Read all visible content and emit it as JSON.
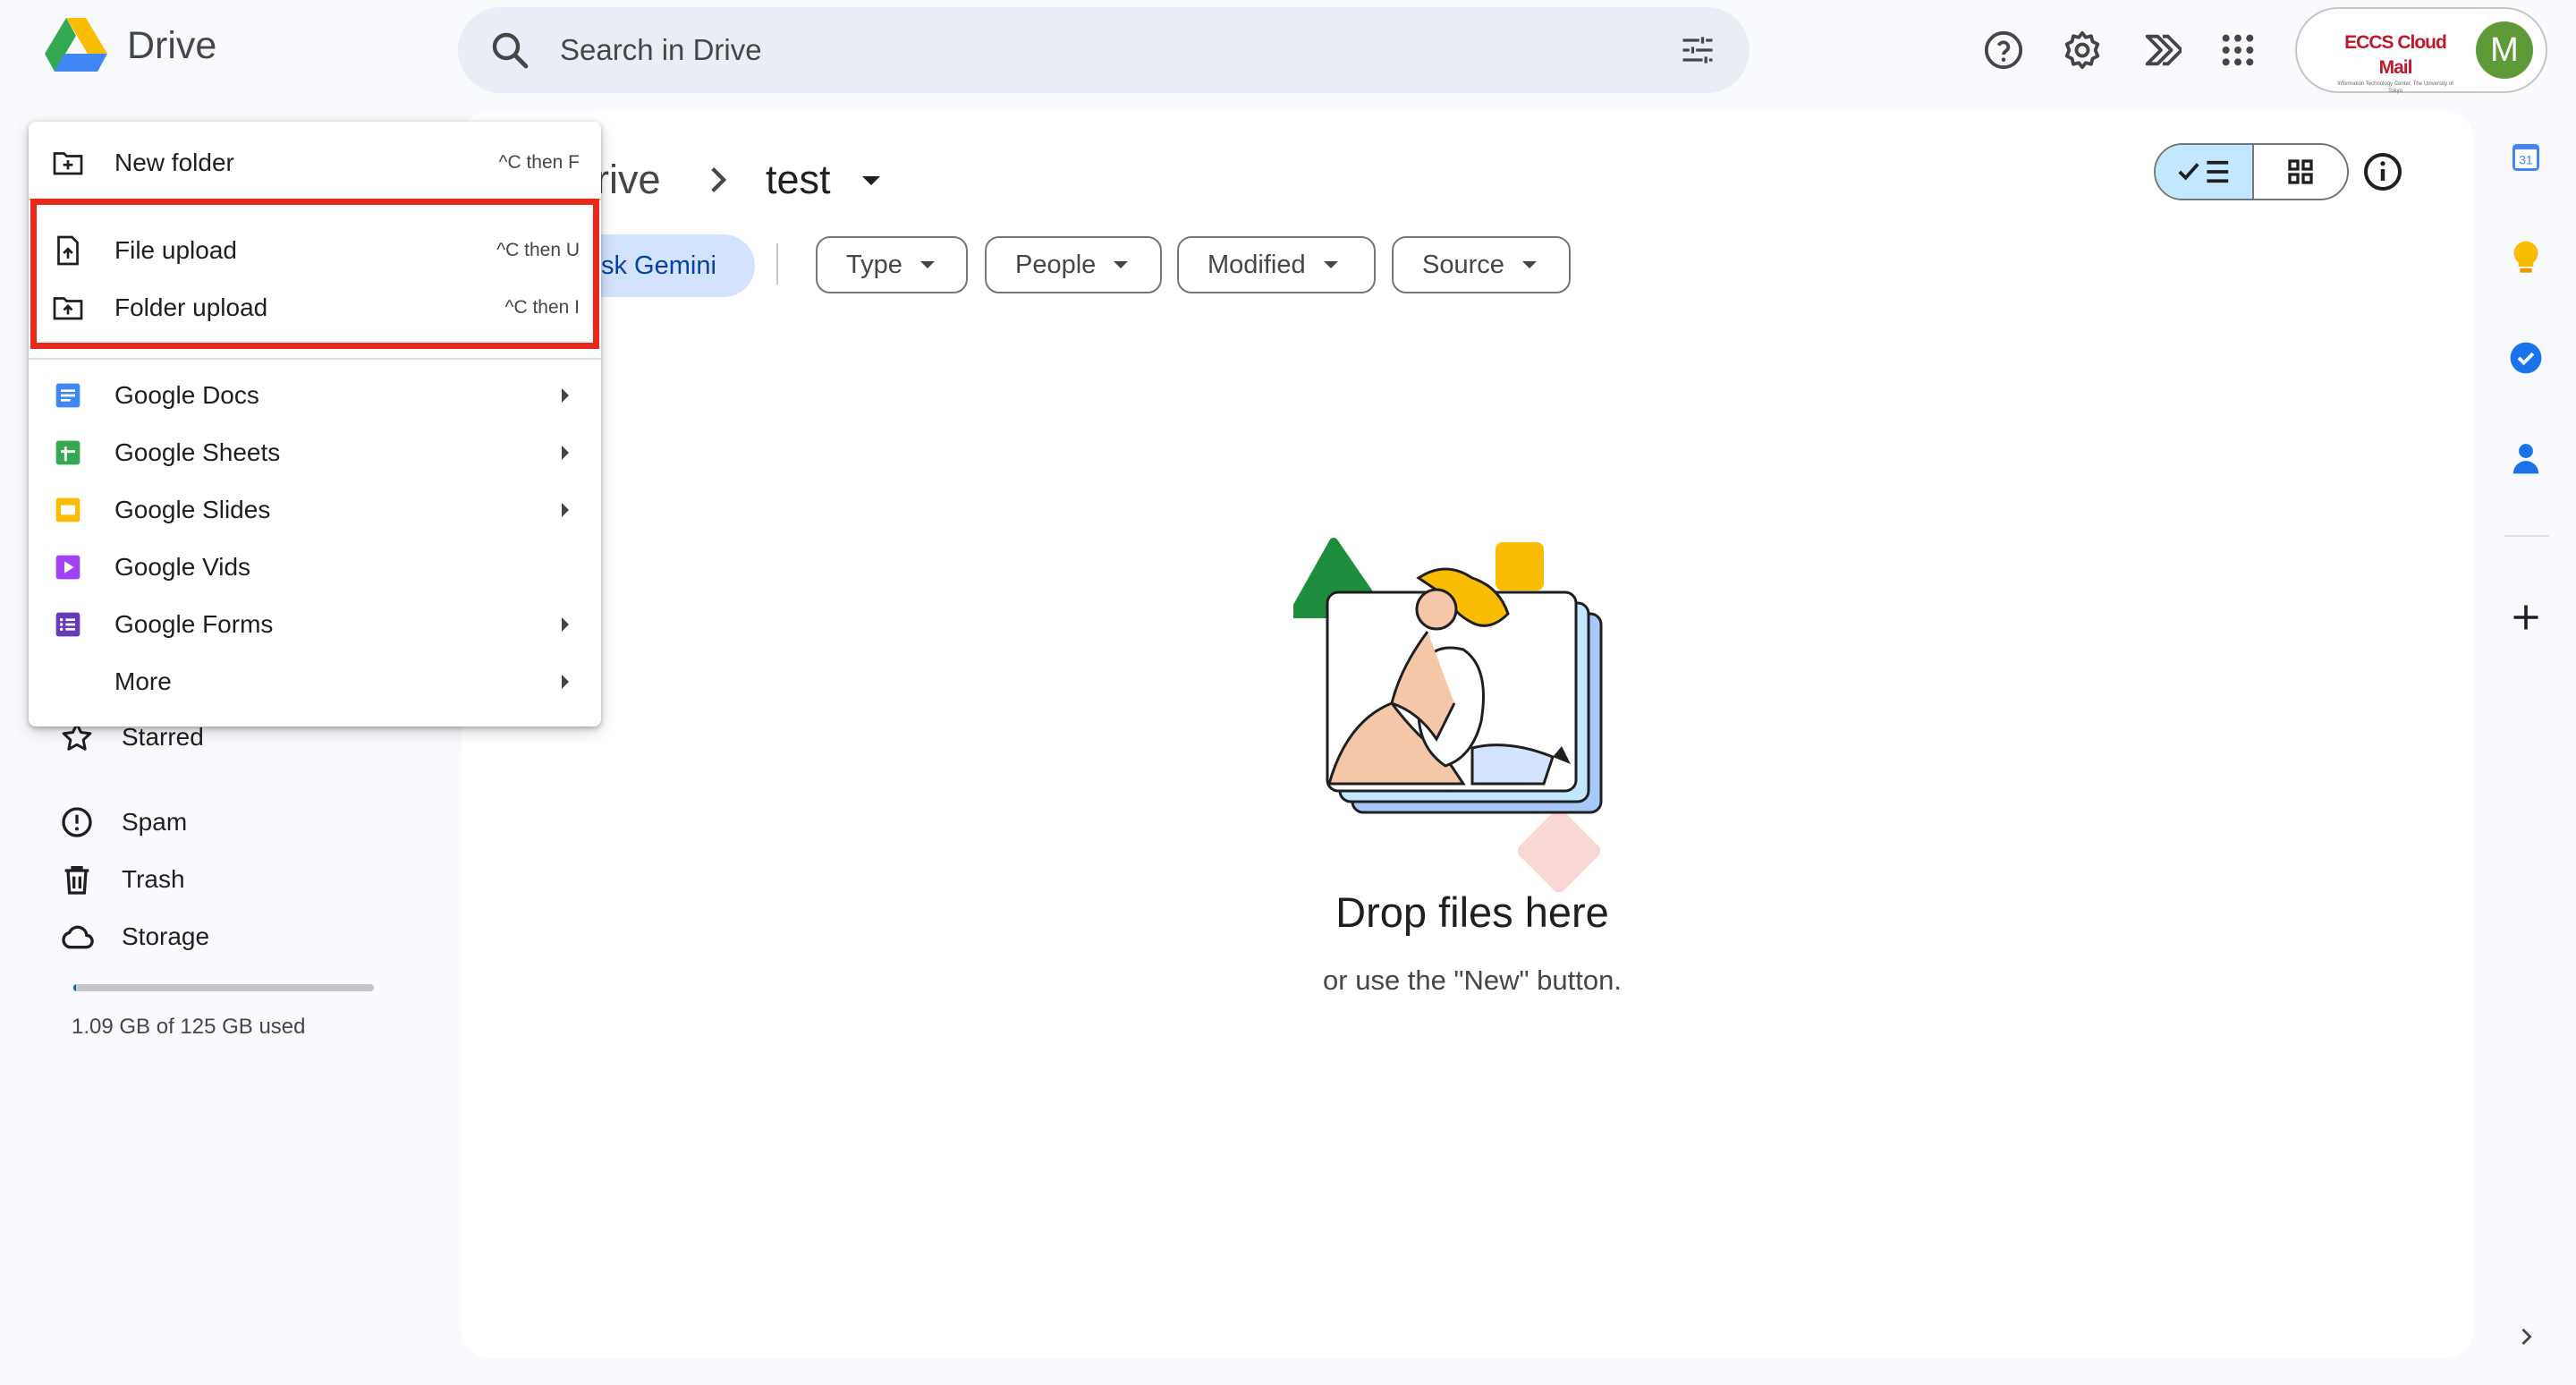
{
  "header": {
    "app_name": "Drive",
    "search_placeholder": "Search in Drive",
    "account_badge_title": "ECCS Cloud Mail",
    "account_badge_sub": "Information Technology Center, The University of Tokyo",
    "avatar_letter": "M"
  },
  "breadcrumb": {
    "parent": "rive",
    "current": "test"
  },
  "ask_gemini": "sk Gemini",
  "filters": [
    "Type",
    "People",
    "Modified",
    "Source"
  ],
  "empty_state": {
    "title": "Drop files here",
    "subtitle": "or use the \"New\" button."
  },
  "menu": {
    "new_folder": {
      "label": "New folder",
      "shortcut": "^C then F"
    },
    "file_upload": {
      "label": "File upload",
      "shortcut": "^C then U"
    },
    "folder_upload": {
      "label": "Folder upload",
      "shortcut": "^C then I"
    },
    "apps": [
      "Google Docs",
      "Google Sheets",
      "Google Slides",
      "Google Vids",
      "Google Forms",
      "More"
    ]
  },
  "nav": {
    "starred": "Starred",
    "spam": "Spam",
    "trash": "Trash",
    "storage": "Storage"
  },
  "storage": {
    "used_text": "1.09 GB of 125 GB used",
    "fraction": 0.0087
  },
  "rail": {
    "calendar_day": "31"
  },
  "colors": {
    "accent": "#0b57d0",
    "highlight_box": "#e8291a",
    "selected_toggle": "#c2e7ff",
    "avatar": "#5f9a39"
  }
}
